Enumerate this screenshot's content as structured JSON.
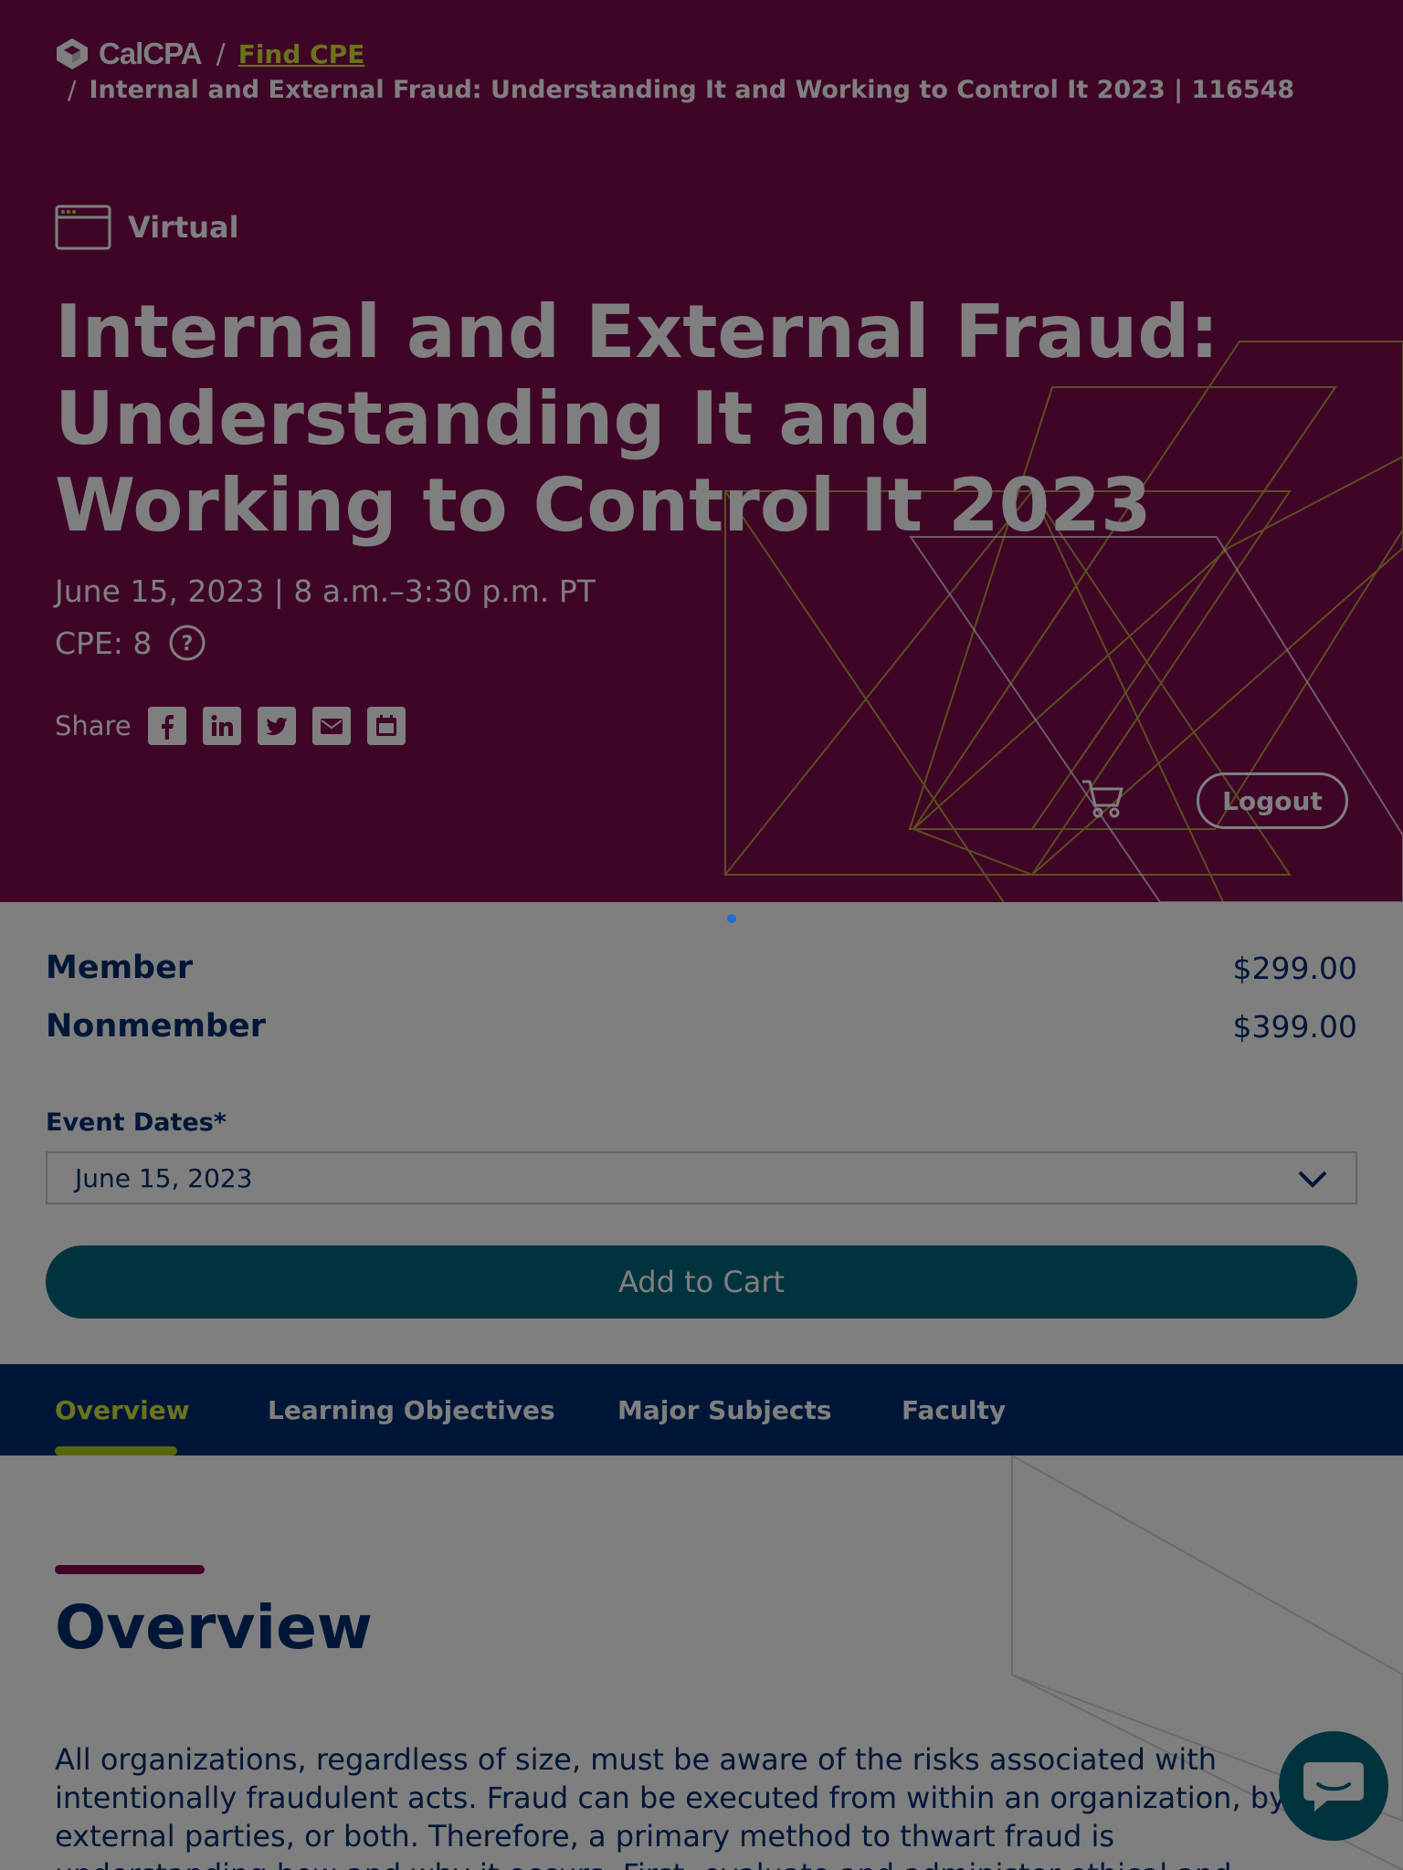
{
  "breadcrumb": {
    "brand": "CalCPA",
    "separator": "/",
    "link_label": "Find CPE",
    "current": "Internal and External Fraud: Understanding It and Working to Control It 2023 | 116548"
  },
  "event": {
    "mode_label": "Virtual",
    "title": "Internal and External Fraud: Understanding It and Working to Control It 2023",
    "date_time": "June 15, 2023 | 8 a.m.–3:30 p.m. PT",
    "cpe": "CPE: 8",
    "share_label": "Share",
    "share_icons": [
      "facebook-icon",
      "linkedin-icon",
      "twitter-icon",
      "email-icon",
      "calendar-icon"
    ]
  },
  "header_actions": {
    "logout_label": "Logout"
  },
  "pricing": {
    "rows": [
      {
        "label": "Member",
        "price": "$299.00"
      },
      {
        "label": "Nonmember",
        "price": "$399.00"
      }
    ],
    "event_dates_label": "Event Dates*",
    "event_dates_selected": "June 15, 2023",
    "add_to_cart_label": "Add to Cart"
  },
  "tabs": [
    {
      "label": "Overview",
      "active": true
    },
    {
      "label": "Learning Objectives",
      "active": false
    },
    {
      "label": "Major Subjects",
      "active": false
    },
    {
      "label": "Faculty",
      "active": false
    }
  ],
  "overview": {
    "heading": "Overview",
    "text": "All organizations, regardless of size, must be aware of the risks associated with intentionally fraudulent acts. Fraud can be executed from within an organization, by external parties, or both. Therefore, a primary method to thwart fraud is understanding how and why it occurs. First, evaluate and administer ethical and intentional defalcation"
  },
  "colors": {
    "hero_bg": "#7e0b4f",
    "accent_lime": "#d6e63a",
    "navy": "#002d6e",
    "teal": "#00677c",
    "overlay": "rgba(0,0,0,0.5)"
  }
}
